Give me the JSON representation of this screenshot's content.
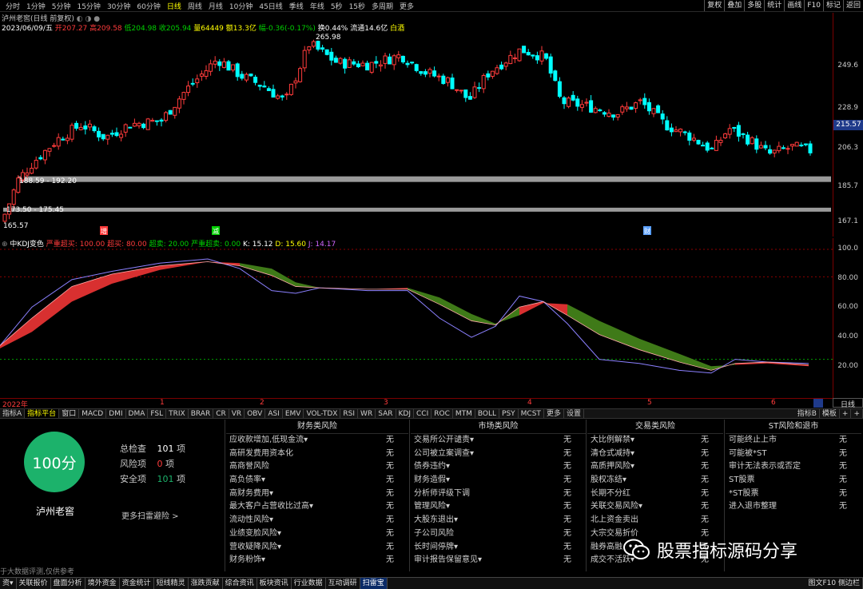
{
  "periods": [
    "分时",
    "1分钟",
    "5分钟",
    "15分钟",
    "30分钟",
    "60分钟",
    "日线",
    "周线",
    "月线",
    "10分钟",
    "45日线",
    "季线",
    "年线",
    "5秒",
    "15秒",
    "多周期",
    "更多"
  ],
  "active_period": "日线",
  "toolbar_buttons": [
    "复权",
    "叠加",
    "多股",
    "统计",
    "画线",
    "F10",
    "标记",
    "返回"
  ],
  "header": {
    "title": "泸州老窖(日线 前复权)",
    "status_icons": "◐ ◑ ●"
  },
  "quote": {
    "date": "2023/06/09/五",
    "open": "开207.27",
    "high": "高209.58",
    "low": "低204.98",
    "close": "收205.94",
    "vol": "量64449",
    "amt": "额13.3亿",
    "chg": "幅-0.36(-0.17%)",
    "turn": "换0.44%",
    "flow": "流通14.6亿",
    "tag": "白酒"
  },
  "price_axis": [
    "249.6",
    "228.9",
    "206.3",
    "185.7",
    "167.1"
  ],
  "current_price": "215.57",
  "chart_labels": {
    "peak": "265.98",
    "zone1": "188.59 - 192.20",
    "zone2": "173.50 - 175.45",
    "low": "165.57"
  },
  "event_markers": [
    "增",
    "减",
    "财"
  ],
  "kdj_header": {
    "name": "中KDJ变色",
    "p1": "严重超买: 100.00",
    "p2": "超买: 80.00",
    "p3": "超卖: 20.00",
    "p4": "严重超卖: 0.00",
    "k": "K: 15.12",
    "d": "D: 15.60",
    "j": "J: 14.17"
  },
  "kdj_axis": [
    "100.0",
    "80.00",
    "60.00",
    "40.00",
    "20.00"
  ],
  "date_labels": [
    "2022年",
    "1",
    "2",
    "3",
    "4",
    "5",
    "6"
  ],
  "day_button": "日线",
  "indicator_tabs": [
    "指标A",
    "指标平台",
    "窗口",
    "MACD",
    "DMI",
    "DMA",
    "FSL",
    "TRIX",
    "BRAR",
    "CR",
    "VR",
    "OBV",
    "ASI",
    "EMV",
    "VOL-TDX",
    "RSI",
    "WR",
    "SAR",
    "KDJ",
    "CCI",
    "ROC",
    "MTM",
    "BOLL",
    "PSY",
    "MCST",
    "更多",
    "设置"
  ],
  "indicator_right": [
    "指标B",
    "模板",
    "+",
    "+"
  ],
  "risk": {
    "score": "100分",
    "stock": "泸州老窖",
    "total_label": "总检查",
    "total": "101",
    "unit": "项",
    "risk_label": "风险项",
    "risk": "0",
    "safe_label": "安全项",
    "safe": "101",
    "more": "更多扫雷避险 >",
    "columns": [
      {
        "title": "财务类风险",
        "items": [
          "应收款增加,低现金流▾",
          "高研发费用资本化",
          "高商誉风险",
          "高负债率▾",
          "高财务费用▾",
          "最大客户占营收比过高▾",
          "流动性风险▾",
          "业绩变脸风险▾",
          "营收疑降风险▾",
          "财务粉饰▾"
        ]
      },
      {
        "title": "市场类风险",
        "items": [
          "交易所公开谴责▾",
          "公司被立案调查▾",
          "债券违约▾",
          "财务造假▾",
          "分析师评级下调",
          "管理风险▾",
          "大股东退出▾",
          "子公司风险",
          "长时间停牌▾",
          "审计报告保留意见▾"
        ]
      },
      {
        "title": "交易类风险",
        "items": [
          "大比例解禁▾",
          "清仓式减持▾",
          "高质押风险▾",
          "股权冻结▾",
          "长期不分红",
          "关联交易风险▾",
          "北上资金卖出",
          "大宗交易折价",
          "融券高融",
          "成交不活跃▾"
        ]
      },
      {
        "title": "ST风险和退市",
        "items": [
          "可能终止上市",
          "可能被*ST",
          "审计无法表示或否定",
          "ST股票",
          "*ST股票",
          "进入退市整理"
        ]
      }
    ],
    "value": "无"
  },
  "footer_note": "于大数据评测,仅供参考",
  "bottom_tabs": [
    "资▾",
    "关联报价",
    "盘面分析",
    "境外资金",
    "资金统计",
    "短线精灵",
    "涨跌贡献",
    "综合资讯",
    "板块资讯",
    "行业数据",
    "互动调研",
    "扫雷宝"
  ],
  "bottom_active": "扫雷宝",
  "bottom_right": "图文F10 侧边栏",
  "watermark": "股票指标源码分享",
  "colors": {
    "up": "#ff3b3b",
    "down": "#00ffff",
    "accent": "#1cb26b"
  }
}
